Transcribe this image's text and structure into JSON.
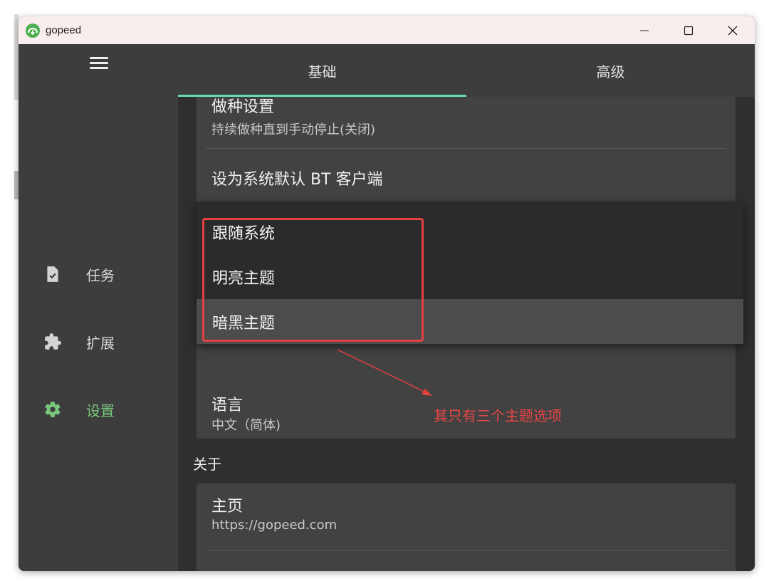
{
  "window": {
    "title": "gopeed"
  },
  "sidebar": {
    "items": [
      {
        "label": "任务",
        "icon": "task-icon"
      },
      {
        "label": "扩展",
        "icon": "extension-icon"
      },
      {
        "label": "设置",
        "icon": "settings-icon",
        "active": true
      }
    ]
  },
  "tabs": [
    {
      "label": "基础",
      "active": true
    },
    {
      "label": "高级",
      "active": false
    }
  ],
  "settings": {
    "seeding": {
      "title": "做种设置",
      "subtitle": "持续做种直到手动停止(关闭)"
    },
    "bt_default": {
      "title": "设为系统默认 BT 客户端"
    },
    "language": {
      "title": "语言",
      "value": "中文（简体)"
    },
    "about_section": "关于",
    "homepage": {
      "title": "主页",
      "value": "https://gopeed.com"
    }
  },
  "theme_dropdown": {
    "options": [
      "跟随系统",
      "明亮主题",
      "暗黑主题"
    ],
    "selected": "暗黑主题"
  },
  "annotation": {
    "text": "其只有三个主题选项"
  },
  "colors": {
    "accent": "#69d8b4",
    "active_nav": "#79c77d",
    "annotation": "#e64040"
  }
}
